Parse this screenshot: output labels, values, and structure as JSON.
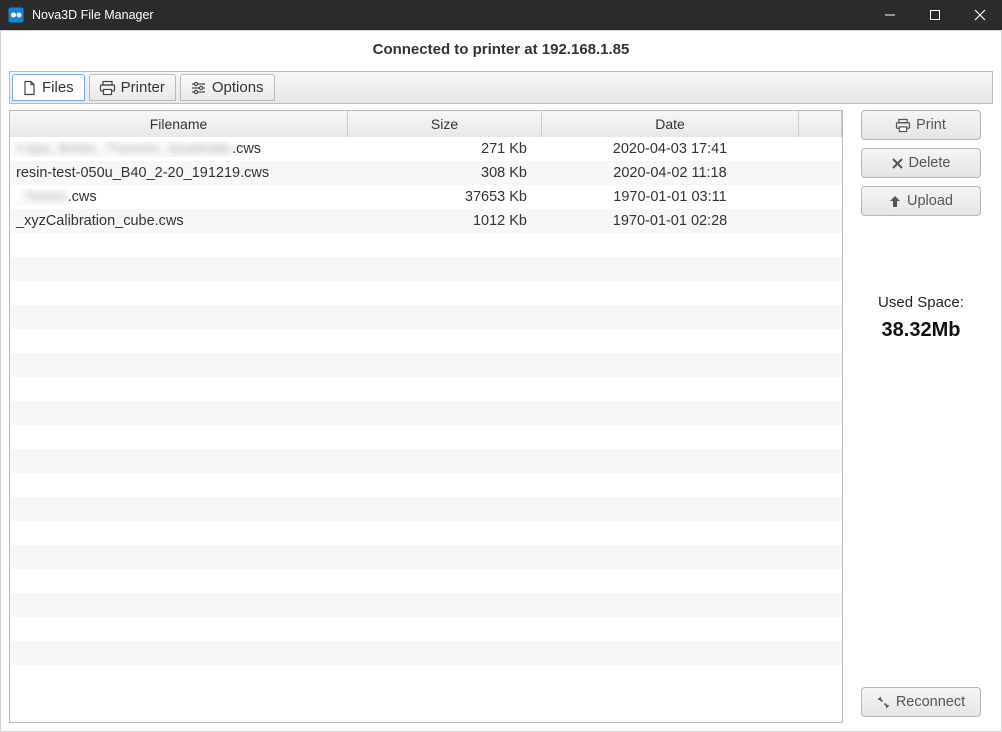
{
  "window": {
    "title": "Nova3D File Manager"
  },
  "status": "Connected to printer at 192.168.1.85",
  "tabs": [
    {
      "label": "Files",
      "icon": "file-icon",
      "selected": true
    },
    {
      "label": "Printer",
      "icon": "printer-icon",
      "selected": false
    },
    {
      "label": "Options",
      "icon": "options-icon",
      "selected": false
    }
  ],
  "table": {
    "columns": {
      "filename": "Filename",
      "size": "Size",
      "date": "Date"
    },
    "rows": [
      {
        "filename_prefix_redacted": "Capa_Botao_Thyssen_Quadrado",
        "filename_suffix": ".cws",
        "size": "271 Kb",
        "date": "2020-04-03 17:41"
      },
      {
        "filename": "resin-test-050u_B40_2-20_191219.cws",
        "size": "308 Kb",
        "date": "2020-04-02 11:18"
      },
      {
        "filename_prefix_redacted": "_Toomo",
        "filename_suffix": ".cws",
        "size": "37653 Kb",
        "date": "1970-01-01 03:11"
      },
      {
        "filename": "_xyzCalibration_cube.cws",
        "size": "1012 Kb",
        "date": "1970-01-01 02:28"
      }
    ],
    "blank_row_count": 19
  },
  "sidebar": {
    "buttons": {
      "print": "Print",
      "delete": "Delete",
      "upload": "Upload",
      "reconnect": "Reconnect"
    },
    "used_space": {
      "label": "Used Space:",
      "value": "38.32Mb"
    }
  }
}
